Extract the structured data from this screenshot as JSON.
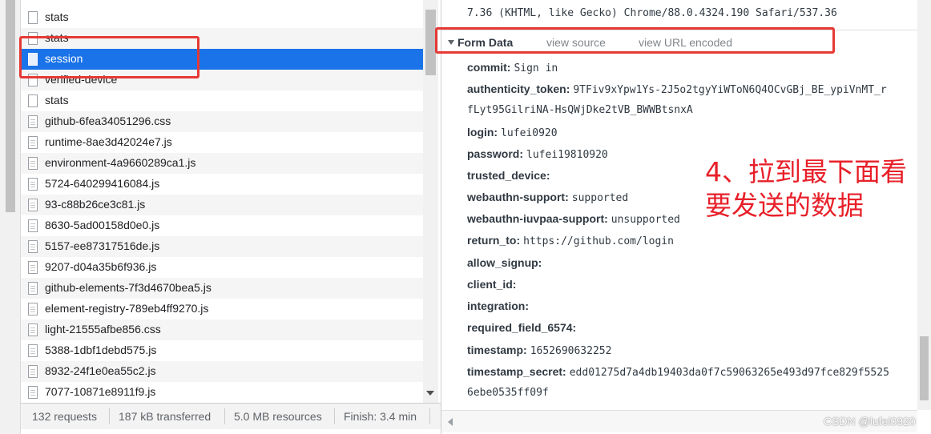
{
  "request_list": {
    "rows": [
      {
        "name": "stats",
        "icon": "plain"
      },
      {
        "name": "stats",
        "icon": "plain"
      },
      {
        "name": "session",
        "icon": "plain",
        "selected": true
      },
      {
        "name": "verified-device",
        "icon": "plain"
      },
      {
        "name": "stats",
        "icon": "plain"
      },
      {
        "name": "github-6fea34051296.css",
        "icon": "doc"
      },
      {
        "name": "runtime-8ae3d42024e7.js",
        "icon": "doc"
      },
      {
        "name": "environment-4a9660289ca1.js",
        "icon": "doc"
      },
      {
        "name": "5724-640299416084.js",
        "icon": "doc"
      },
      {
        "name": "93-c88b26ce3c81.js",
        "icon": "doc"
      },
      {
        "name": "8630-5ad00158d0e0.js",
        "icon": "doc"
      },
      {
        "name": "5157-ee87317516de.js",
        "icon": "doc"
      },
      {
        "name": "9207-d04a35b6f936.js",
        "icon": "doc"
      },
      {
        "name": "github-elements-7f3d4670bea5.js",
        "icon": "doc"
      },
      {
        "name": "element-registry-789eb4ff9270.js",
        "icon": "doc"
      },
      {
        "name": "light-21555afbe856.css",
        "icon": "doc"
      },
      {
        "name": "5388-1dbf1debd575.js",
        "icon": "doc"
      },
      {
        "name": "8932-24f1e0ea55c2.js",
        "icon": "doc"
      },
      {
        "name": "7077-10871e8911f9.js",
        "icon": "doc"
      }
    ]
  },
  "status_bar": {
    "requests": "132 requests",
    "transferred": "187 kB transferred",
    "resources": "5.0 MB resources",
    "finish": "Finish: 3.4 min"
  },
  "detail": {
    "ua_line": "7.36 (KHTML, like Gecko) Chrome/88.0.4324.190 Safari/537.36",
    "section_title": "Form Data",
    "view_source": "view source",
    "view_url_encoded": "view URL encoded",
    "fields": {
      "commit": {
        "key": "commit:",
        "value": "Sign in"
      },
      "authenticity_token": {
        "key": "authenticity_token:",
        "value": "9TFiv9xYpw1Ys-2J5o2tgyYiWToN6Q4OCvGBj_BE_ypiVnMT_r",
        "cont": "fLyt95GilriNA-HsQWjDke2tVB_BWWBtsnxA"
      },
      "login": {
        "key": "login:",
        "value": "lufei0920"
      },
      "password": {
        "key": "password:",
        "value": "lufei19810920"
      },
      "trusted_device": {
        "key": "trusted_device:",
        "value": ""
      },
      "webauthn_support": {
        "key": "webauthn-support:",
        "value": "supported"
      },
      "webauthn_iuvpaa_support": {
        "key": "webauthn-iuvpaa-support:",
        "value": "unsupported"
      },
      "return_to": {
        "key": "return_to:",
        "value": "https://github.com/login"
      },
      "allow_signup": {
        "key": "allow_signup:",
        "value": ""
      },
      "client_id": {
        "key": "client_id:",
        "value": ""
      },
      "integration": {
        "key": "integration:",
        "value": ""
      },
      "required_field": {
        "key": "required_field_6574:",
        "value": ""
      },
      "timestamp": {
        "key": "timestamp:",
        "value": "1652690632252"
      },
      "timestamp_secret": {
        "key": "timestamp_secret:",
        "value": "edd01275d7a4db19403da0f7c59063265e493d97fce829f5525",
        "cont": "6ebe0535ff09f"
      }
    }
  },
  "annotation": {
    "line1": "4、拉到最下面看",
    "line2": "要发送的数据",
    "color": "#e8202a"
  },
  "watermark": "CSDN @lufei0920"
}
